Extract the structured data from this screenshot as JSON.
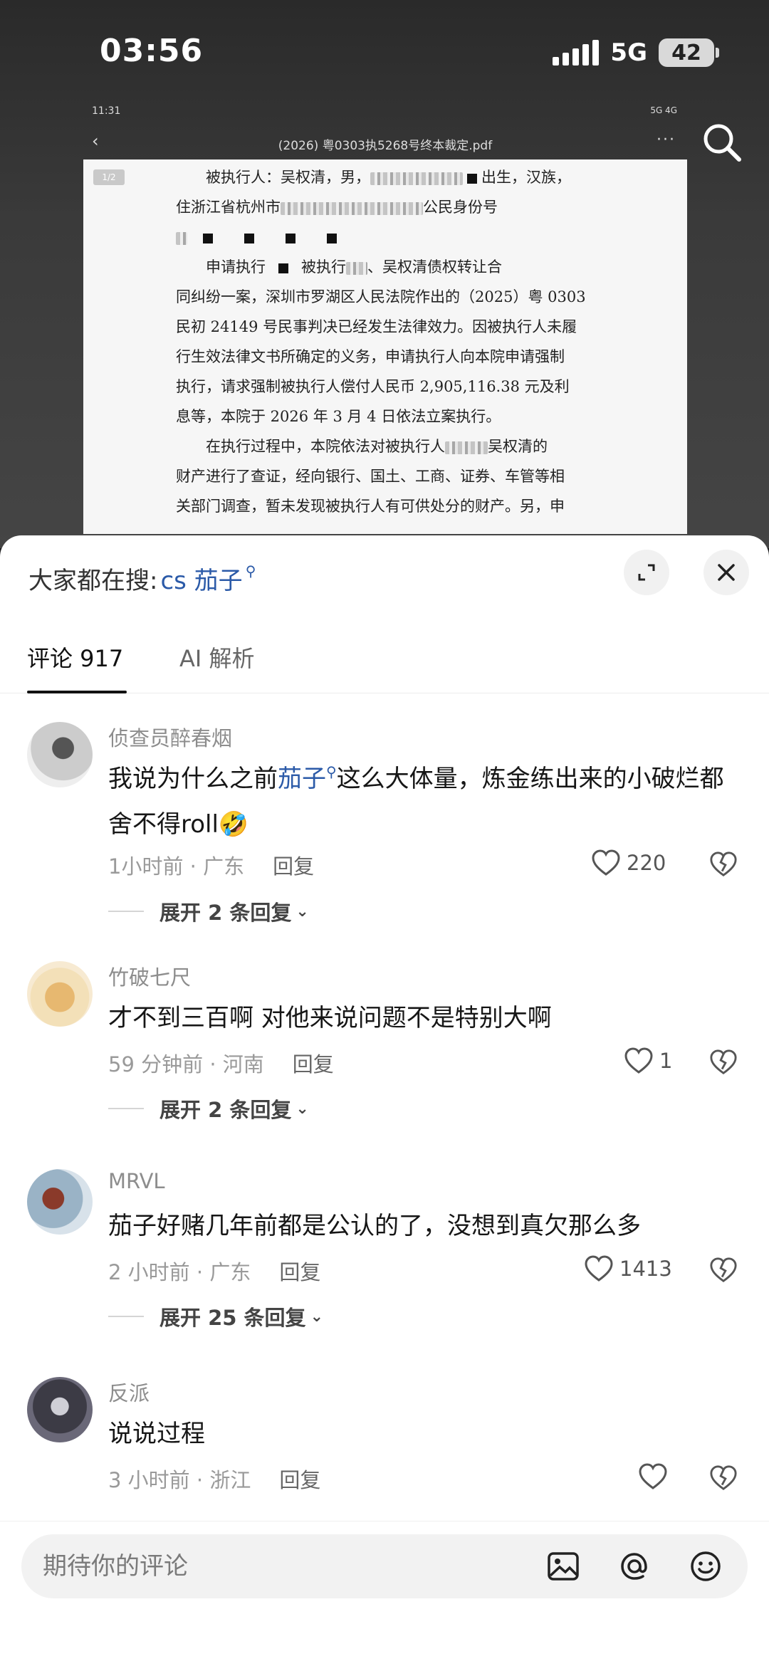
{
  "status_bar": {
    "time": "03:56",
    "network": "5G",
    "battery": "42"
  },
  "doc": {
    "inner_time": "11:31",
    "inner_right": "5G 4G",
    "title": "(2026) 粤0303执5268号终本裁定.pdf",
    "page_badge": "1/2",
    "lines": [
      "被执行人：吴权清，男，",
      "出生，汉族，",
      "住浙江省杭州市",
      "公民身份号",
      "申请执行",
      "被执行",
      "、吴权清债权转让合",
      "同纠纷一案，深圳市罗湖区人民法院作出的（2025）粤 0303",
      "民初 24149 号民事判决已经发生法律效力。因被执行人未履",
      "行生效法律文书所确定的义务，申请执行人向本院申请强制",
      "执行，请求强制被执行人偿付人民币 2,905,116.38 元及利",
      "息等，本院于 2026 年 3 月 4 日依法立案执行。",
      "在执行过程中，本院依法对被执行人",
      "吴权清的",
      "财产进行了查证，经向银行、国土、工商、证券、车管等相",
      "关部门调查，暂未发现被执行人有可供处分的财产。另，申"
    ]
  },
  "sheet": {
    "search_prefix": "大家都在搜:",
    "search_keyword": "cs 茄子",
    "tabs": [
      {
        "label": "评论 917",
        "active": true
      },
      {
        "label": "AI 解析",
        "active": false
      }
    ],
    "comments": [
      {
        "user": "侦查员醉春烟",
        "text_before": "我说为什么之前",
        "text_link": "茄子",
        "text_after": "这么大体量，炼金练出来的小破烂都舍不得roll🤣",
        "time_loc": "1小时前 · 广东",
        "reply": "回复",
        "likes": "220",
        "expand": "展开 2 条回复"
      },
      {
        "user": "竹破七尺",
        "text": "才不到三百啊 对他来说问题不是特别大啊",
        "time_loc": "59 分钟前 · 河南",
        "reply": "回复",
        "likes": "1",
        "expand": "展开 2 条回复"
      },
      {
        "user": "MRVL",
        "text": "茄子好赌几年前都是公认的了，没想到真欠那么多",
        "time_loc": "2 小时前 · 广东",
        "reply": "回复",
        "likes": "1413",
        "expand": "展开 25 条回复"
      },
      {
        "user": "反派",
        "text": "说说过程",
        "time_loc": "3 小时前 · 浙江",
        "reply": "回复",
        "likes": ""
      }
    ],
    "input_placeholder": "期待你的评论"
  },
  "icons": {
    "search": "search-icon",
    "expand": "expand-icon",
    "close": "close-icon",
    "heart": "heart-icon",
    "dislike": "broken-heart-icon",
    "image": "image-icon",
    "mention": "at-icon",
    "emoji": "emoji-icon"
  }
}
